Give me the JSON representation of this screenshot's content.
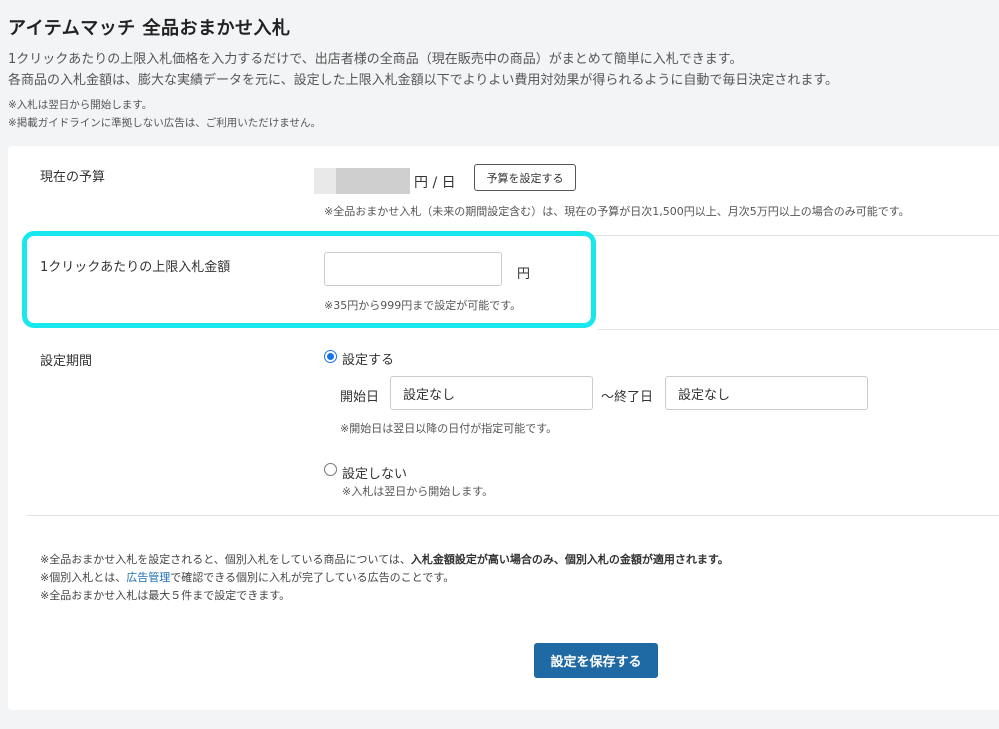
{
  "header": {
    "title": "アイテムマッチ 全品おまかせ入札",
    "description_1": "1クリックあたりの上限入札価格を入力するだけで、出店者様の全商品（現在販売中の商品）がまとめて簡単に入札できます。",
    "description_2": "各商品の入札金額は、膨大な実績データを元に、設定した上限入札金額以下でよりよい費用対効果が得られるように自動で毎日決定されます。",
    "note_1": "※入札は翌日から開始します。",
    "note_2": "※掲載ガイドラインに準拠しない広告は、ご利用いただけません。"
  },
  "budget": {
    "label": "現在の予算",
    "unit": "円 / 日",
    "set_button": "予算を設定する",
    "note": "※全品おまかせ入札（未来の期間設定含む）は、現在の予算が日次1,500円以上、月次5万円以上の場合のみ可能です。"
  },
  "bid": {
    "label": "1クリックあたりの上限入札金額",
    "value": "",
    "unit": "円",
    "note": "※35円から999円まで設定が可能です。"
  },
  "period": {
    "label": "設定期間",
    "option_set": "設定する",
    "option_unset": "設定しない",
    "selected": "設定する",
    "start_label": "開始日",
    "start_value": "設定なし",
    "separator_end_label": "～終了日",
    "end_value": "設定なし",
    "date_note": "※開始日は翌日以降の日付が指定可能です。",
    "unset_note": "※入札は翌日から開始します。"
  },
  "footnotes": {
    "line1_prefix": "※全品おまかせ入札を設定されると、個別入札をしている商品については、",
    "line1_bold": "入札金額設定が高い場合のみ、個別入札の金額が適用されます。",
    "line2_prefix": "※個別入札とは、",
    "line2_link": "広告管理",
    "line2_suffix": "で確認できる個別に入札が完了している広告のことです。",
    "line3": "※全品おまかせ入札は最大５件まで設定できます。"
  },
  "save_button": "設定を保存する",
  "colors": {
    "highlight": "#19e7ee",
    "primary": "#1f6aa5",
    "link": "#1a6fb5"
  }
}
